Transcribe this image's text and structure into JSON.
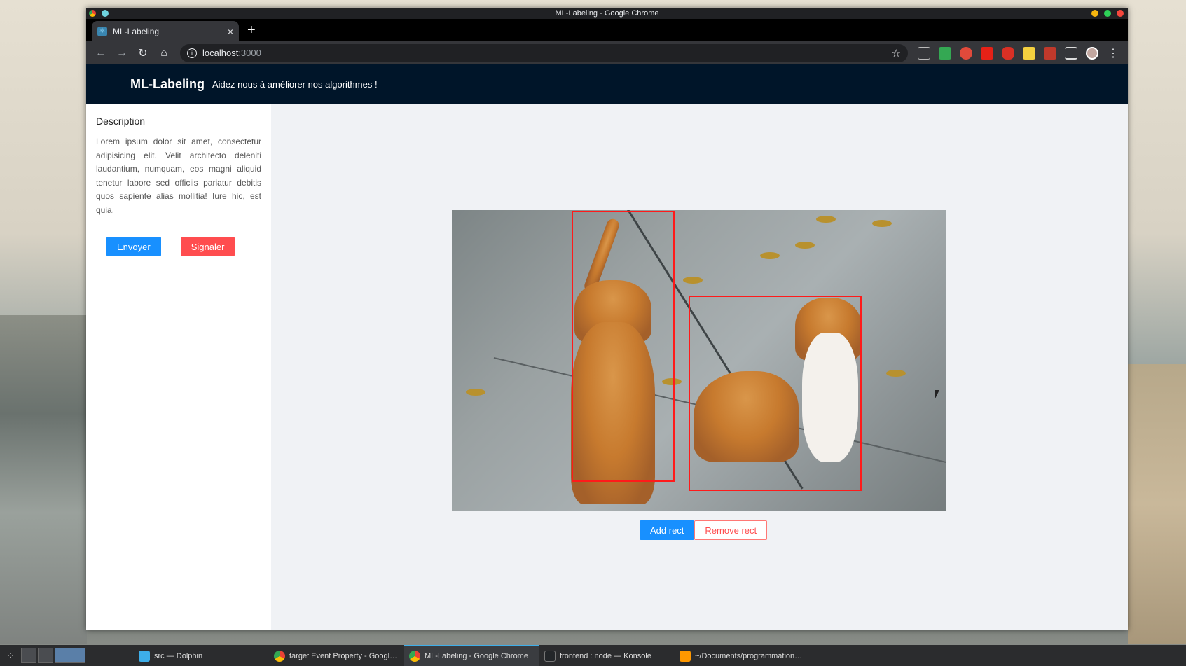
{
  "window": {
    "title": "ML-Labeling - Google Chrome"
  },
  "browser": {
    "tab": {
      "title": "ML-Labeling",
      "close": "×"
    },
    "new_tab": "+",
    "address": {
      "host": "localhost",
      "port": ":3000"
    }
  },
  "app": {
    "brand": "ML-Labeling",
    "tagline": "Aidez nous à améliorer nos algorithmes !"
  },
  "sidebar": {
    "title": "Description",
    "text": "Lorem ipsum dolor sit amet, consectetur adipisicing elit. Velit architecto deleniti laudantium, numquam, eos magni aliquid tenetur labore sed officiis pariatur debitis quos sapiente alias mollitia! Iure hic, est quia.",
    "send_label": "Envoyer",
    "report_label": "Signaler"
  },
  "canvas": {
    "add_label": "Add rect",
    "remove_label": "Remove rect"
  },
  "taskbar": {
    "tasks": [
      {
        "label": "src — Dolphin",
        "icon": "folder-icon"
      },
      {
        "label": "target Event Property - Google C...",
        "icon": "chrome-icon"
      },
      {
        "label": "ML-Labeling - Google Chrome",
        "icon": "chrome-icon"
      },
      {
        "label": "frontend : node — Konsole",
        "icon": "terminal-icon"
      },
      {
        "label": "~/Documents/programmation/ml...",
        "icon": "sublime-icon"
      }
    ]
  },
  "colors": {
    "header_bg": "#001529",
    "primary": "#1890ff",
    "danger": "#ff4d4f",
    "rect_stroke": "#ff1a1a"
  }
}
